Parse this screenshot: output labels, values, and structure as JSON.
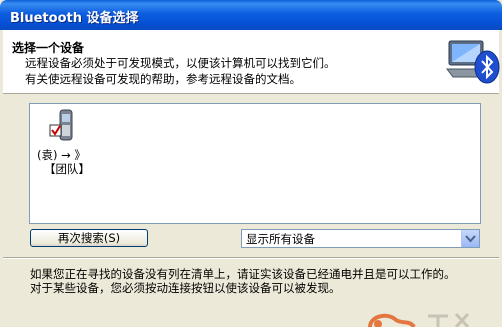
{
  "window": {
    "title": "Bluetooth 设备选择"
  },
  "header": {
    "heading": "选择一个设备",
    "line1": "远程设备必须处于可发现模式，以便该计算机可以找到它们。",
    "line2": "有关使远程设备可发现的帮助，参考远程设备的文档。",
    "icon": "bluetooth-computer-icon"
  },
  "devices": [
    {
      "icon": "mobile-phone-icon",
      "name": "(袁) → 》",
      "group": "【团队】"
    }
  ],
  "toolbar": {
    "search_again_label": "再次搜索(S)",
    "filter_selected": "显示所有设备"
  },
  "footer": {
    "line1": "如果您正在寻找的设备没有列在清单上，请证实该设备已经通电并且是可以工作的。",
    "line2": "对于某些设备，您必须按动连接按钮以使该设备可以被发现。"
  },
  "colors": {
    "titlebar": "#0550d4",
    "accent": "#0a5fd8",
    "window_bg": "#ece9d8"
  }
}
